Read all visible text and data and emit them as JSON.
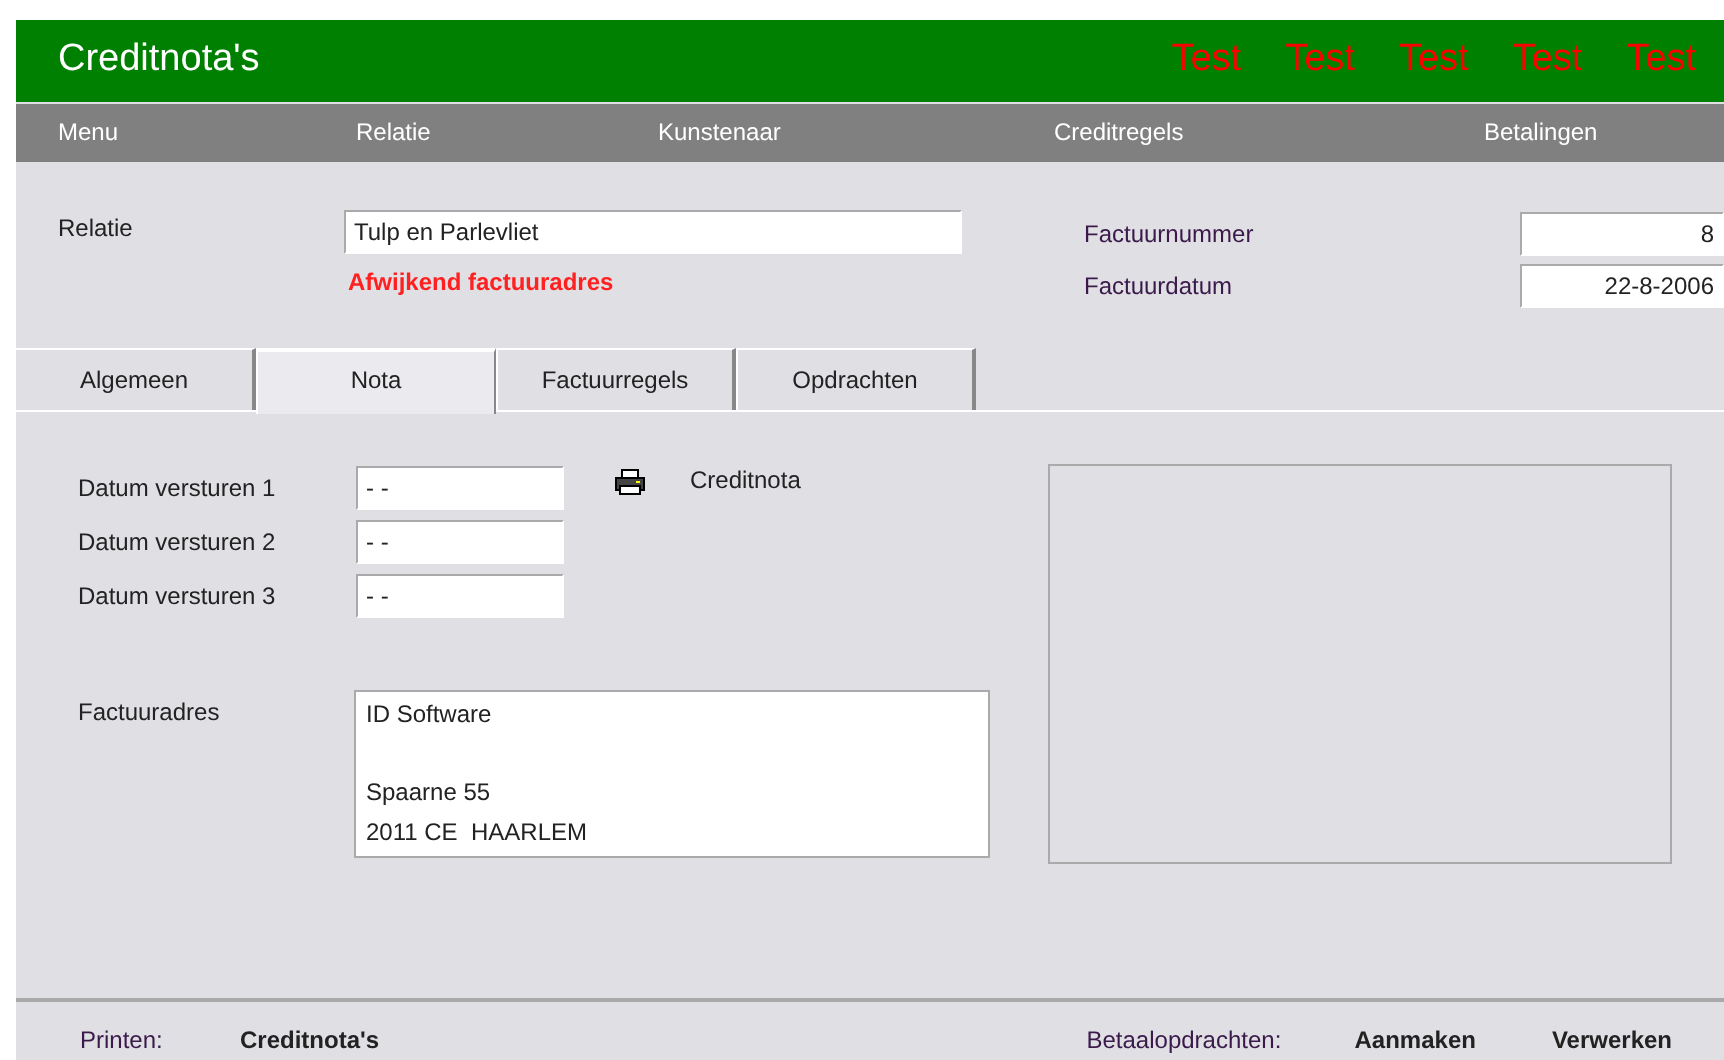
{
  "header": {
    "title": "Creditnota's",
    "badges": [
      "Test",
      "Test",
      "Test",
      "Test",
      "Test"
    ]
  },
  "nav": [
    "Menu",
    "Relatie",
    "Kunstenaar",
    "Creditregels",
    "Betalingen"
  ],
  "relatie": {
    "label": "Relatie",
    "value": "Tulp en Parlevliet",
    "warning": "Afwijkend factuuradres"
  },
  "invoice": [
    {
      "label": "Factuurnummer",
      "value": "8"
    },
    {
      "label": "Factuurdatum",
      "value": "22-8-2006"
    }
  ],
  "tabs": [
    {
      "label": "Algemeen",
      "selected": false
    },
    {
      "label": "Nota",
      "selected": true
    },
    {
      "label": "Factuurregels",
      "selected": false
    },
    {
      "label": "Opdrachten",
      "selected": false
    }
  ],
  "send_dates": [
    {
      "label": "Datum versturen 1",
      "value": "- -"
    },
    {
      "label": "Datum versturen 2",
      "value": "- -"
    },
    {
      "label": "Datum versturen 3",
      "value": "- -"
    }
  ],
  "print_link": "Creditnota",
  "address": {
    "label": "Factuuradres",
    "lines": [
      {
        "text": "ID Software",
        "blank_before": false
      },
      {
        "text": "Spaarne 55",
        "blank_before": true
      },
      {
        "text": "2011 CE  HAARLEM",
        "blank_before": false
      }
    ]
  },
  "footer": {
    "print_label": "Printen:",
    "print_action": "Creditnota's",
    "payments_label": "Betaalopdrachten:",
    "actions": [
      "Aanmaken",
      "Verwerken"
    ]
  }
}
